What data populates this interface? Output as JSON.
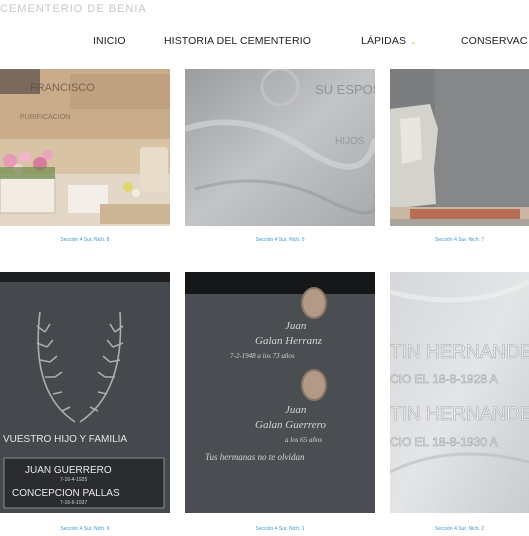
{
  "header": {
    "site_name": "CEMENTERIO DE BENIA"
  },
  "nav": {
    "items": [
      {
        "label": "INICIO"
      },
      {
        "label": "HISTORIA DEL CEMENTERIO"
      },
      {
        "label": "LÁPIDAS",
        "has_dropdown": true
      },
      {
        "label": "CONSERVAC"
      }
    ],
    "accent_color": "#e8b82a"
  },
  "gallery": {
    "captions": [
      "Sección 4 Sur, Nich. 8",
      "Sección 4 Sur, Nich. 5",
      "Sección 4 Sur, Nich. 7",
      "Sección 4 Sur, Nich. 6",
      "Sección 4 Sur, Nich. 1",
      "Sección 4 Sur, Nich. 2"
    ],
    "caption_color": "#3a9ad9",
    "tiles": [
      {
        "text": [
          "FRANCISCO",
          "PURIFICACION"
        ]
      },
      {
        "text": [
          "SU ESPOSA",
          "HIJOS"
        ]
      },
      {
        "text": []
      },
      {
        "text": [
          "VUESTRO HIJO Y FAMILIA",
          "JUAN GUERRERO",
          "7-16-4-1925",
          "CONCEPCION PALLAS",
          "7-16-6-1937"
        ]
      },
      {
        "text": [
          "Juan",
          "Galan Herranz",
          "7-2-1948 a los 73 años",
          "Juan",
          "Galan Guerrero",
          "a los 65 años",
          "Tus hermanas no te olvidan"
        ]
      },
      {
        "text": [
          "TIN HERNANDE",
          "CIO EL 18-8-1928 A",
          "TIN HERNANDE",
          "CIO EL 18-8-1930 A"
        ]
      }
    ]
  }
}
